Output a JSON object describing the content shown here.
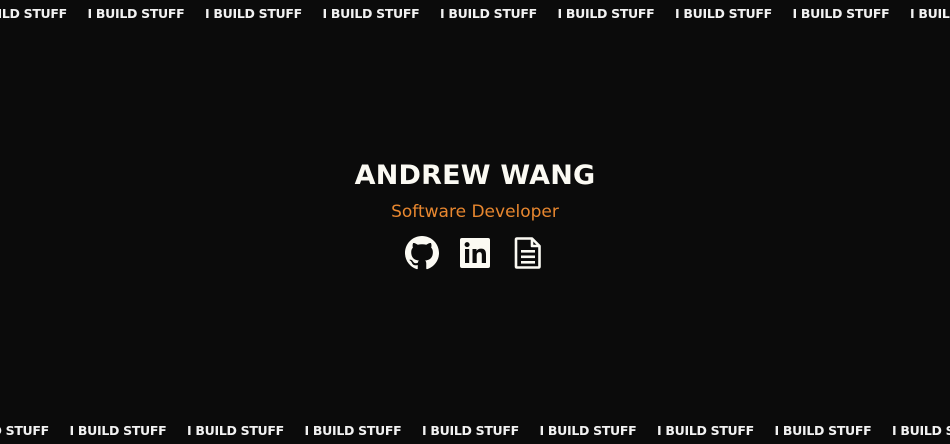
{
  "marquee": {
    "text": "I BUILD STUFF",
    "repeat_count": 10
  },
  "hero": {
    "name": "ANDREW WANG",
    "subtitle": "Software Developer"
  },
  "links": [
    {
      "icon": "github-icon",
      "label": "GitHub"
    },
    {
      "icon": "linkedin-icon",
      "label": "LinkedIn"
    },
    {
      "icon": "resume-icon",
      "label": "Resume"
    }
  ],
  "colors": {
    "background": "#0b0b0b",
    "name": "#fbfaf3",
    "accent": "#e8872f",
    "marquee_text": "#f2f2f2"
  }
}
